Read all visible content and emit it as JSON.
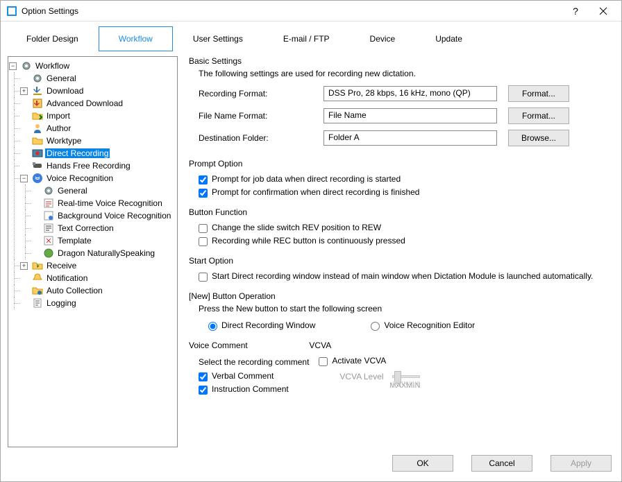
{
  "title": "Option Settings",
  "tabs": [
    "Folder Design",
    "Workflow",
    "User Settings",
    "E-mail / FTP",
    "Device",
    "Update"
  ],
  "active_tab": 1,
  "tree": {
    "root": "Workflow",
    "items": [
      {
        "label": "General",
        "icon": "gear"
      },
      {
        "label": "Download",
        "icon": "download",
        "expanded": false,
        "children": true
      },
      {
        "label": "Advanced Download",
        "icon": "adv-download"
      },
      {
        "label": "Import",
        "icon": "folder-in"
      },
      {
        "label": "Author",
        "icon": "author"
      },
      {
        "label": "Worktype",
        "icon": "worktype"
      },
      {
        "label": "Direct Recording",
        "icon": "direct-rec",
        "selected": true
      },
      {
        "label": "Hands Free Recording",
        "icon": "handsfree"
      },
      {
        "label": "Voice Recognition",
        "icon": "voice",
        "expanded": true,
        "children": true,
        "sub": [
          {
            "label": "General",
            "icon": "gear"
          },
          {
            "label": "Real-time Voice Recognition",
            "icon": "realtime"
          },
          {
            "label": "Background Voice Recognition",
            "icon": "background"
          },
          {
            "label": "Text Correction",
            "icon": "text-corr"
          },
          {
            "label": "Template",
            "icon": "template"
          },
          {
            "label": "Dragon NaturallySpeaking",
            "icon": "dragon"
          }
        ]
      },
      {
        "label": "Receive",
        "icon": "receive",
        "expanded": false,
        "children": true
      },
      {
        "label": "Notification",
        "icon": "notification"
      },
      {
        "label": "Auto Collection",
        "icon": "auto-coll"
      },
      {
        "label": "Logging",
        "icon": "logging"
      }
    ]
  },
  "basic": {
    "title": "Basic Settings",
    "desc": "The following settings are used for recording new dictation.",
    "format_label": "Recording Format:",
    "format_value": "DSS Pro, 28 kbps, 16 kHz, mono (QP)",
    "format_btn": "Format...",
    "file_label": "File Name Format:",
    "file_value": "File Name",
    "file_btn": "Format...",
    "dest_label": "Destination Folder:",
    "dest_value": "Folder A",
    "dest_btn": "Browse..."
  },
  "prompt": {
    "title": "Prompt Option",
    "p1": "Prompt for job data when direct recording is started",
    "p2": "Prompt for confirmation when direct recording is finished"
  },
  "button_fn": {
    "title": "Button Function",
    "b1": "Change the slide switch REV position to REW",
    "b2": "Recording while REC button is continuously pressed"
  },
  "start": {
    "title": "Start Option",
    "s1": "Start Direct recording window instead of main window when Dictation Module is launched automatically."
  },
  "newbtn": {
    "title": "[New] Button Operation",
    "desc": "Press the New button to start the following screen",
    "r1": "Direct Recording Window",
    "r2": "Voice Recognition Editor"
  },
  "voice_comment": {
    "title": "Voice Comment",
    "desc": "Select the recording comment",
    "c1": "Verbal Comment",
    "c2": "Instruction Comment"
  },
  "vcva": {
    "title": "VCVA",
    "activate": "Activate VCVA",
    "level_label": "VCVA Level",
    "max": "MAX",
    "min": "MIN"
  },
  "buttons": {
    "ok": "OK",
    "cancel": "Cancel",
    "apply": "Apply"
  }
}
